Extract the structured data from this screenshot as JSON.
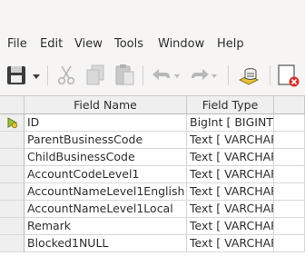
{
  "menu": [
    "File",
    "Edit",
    "View",
    "Tools",
    "Window",
    "Help"
  ],
  "toolbar": {
    "icons": [
      "save-icon",
      "dropdown-arrow-icon",
      "cut-icon",
      "copy-icon",
      "paste-icon",
      "undo-icon",
      "redo-icon",
      "index-design-icon",
      "delete-icon"
    ]
  },
  "table": {
    "columns": [
      "Field Name",
      "Field Type"
    ],
    "rows": [
      {
        "name": "ID",
        "type": "BigInt [ BIGINT ]",
        "key": true
      },
      {
        "name": "ParentBusinessCode",
        "type": "Text [ VARCHAR ]"
      },
      {
        "name": "ChildBusinessCode",
        "type": "Text [ VARCHAR ]"
      },
      {
        "name": "AccountCodeLevel1",
        "type": "Text [ VARCHAR ]"
      },
      {
        "name": "AccountNameLevel1English",
        "type": "Text [ VARCHAR ]"
      },
      {
        "name": "AccountNameLevel1Local",
        "type": "Text [ VARCHAR ]"
      },
      {
        "name": "Remark",
        "type": "Text [ VARCHAR ]"
      },
      {
        "name": "Blocked1NULL",
        "type": "Text [ VARCHAR ]"
      }
    ]
  }
}
